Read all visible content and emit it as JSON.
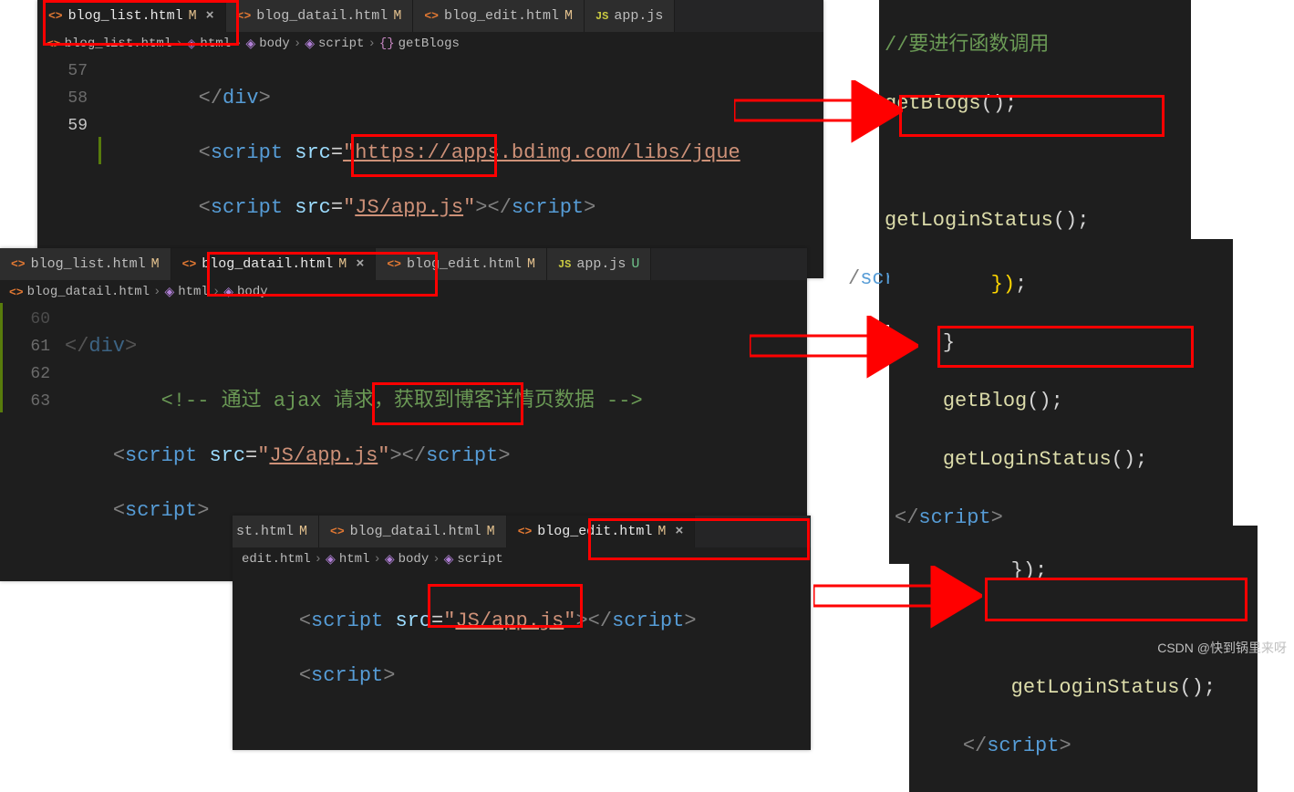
{
  "block1": {
    "tabs": [
      {
        "icon": "<>",
        "label": "blog_list.html",
        "flag": "M",
        "flagClass": "fm",
        "active": true,
        "close": true
      },
      {
        "icon": "<>",
        "label": "blog_datail.html",
        "flag": "M",
        "flagClass": "fm"
      },
      {
        "icon": "<>",
        "label": "blog_edit.html",
        "flag": "M",
        "flagClass": "fm"
      },
      {
        "icon": "JS",
        "label": "app.js",
        "flag": "",
        "iconClass": "js-icon"
      }
    ],
    "crumbs": [
      {
        "icon": "<>",
        "text": "blog_list.html",
        "iconClass": "file-icon"
      },
      {
        "icon": "◈",
        "text": "html",
        "iconClass": "cube"
      },
      {
        "icon": "◈",
        "text": "body",
        "iconClass": "cube"
      },
      {
        "icon": "◈",
        "text": "script",
        "iconClass": "cube"
      },
      {
        "icon": "{}",
        "text": "getBlogs",
        "iconClass": "bracket"
      }
    ],
    "lines": {
      "n57": "57",
      "n58": "58",
      "n59": "59",
      "l57_a": "</",
      "l57_b": "div",
      "l57_c": ">",
      "l58_a": "<",
      "l58_b": "script",
      "l58_c": " ",
      "l58_d": "src",
      "l58_e": "=",
      "l58_f": "\"https://apps.bdimg.com/libs/jque",
      "l59_a": "<",
      "l59_b": "script",
      "l59_c": " ",
      "l59_d": "src",
      "l59_e": "=",
      "l59_f": "\"",
      "l59_g": "JS/app.js",
      "l59_h": "\"",
      "l59_i": "></",
      "l59_j": "script",
      "l59_k": ">"
    }
  },
  "snippet1": {
    "l1": "//要进行函数调用",
    "l2a": "getBlogs",
    "l2b": "();",
    "l3": "",
    "l4a": "getLoginStatus",
    "l4b": "();",
    "l5a": "/",
    "l5b": "script",
    "l5c": ">"
  },
  "block2": {
    "tabs": [
      {
        "icon": "<>",
        "label": "blog_list.html",
        "flag": "M",
        "flagClass": "fm"
      },
      {
        "icon": "<>",
        "label": "blog_datail.html",
        "flag": "M",
        "flagClass": "fm",
        "active": true,
        "close": true
      },
      {
        "icon": "<>",
        "label": "blog_edit.html",
        "flag": "M",
        "flagClass": "fm"
      },
      {
        "icon": "JS",
        "label": "app.js",
        "flag": "U",
        "flagClass": "fu",
        "iconClass": "js-icon"
      }
    ],
    "crumbs": [
      {
        "icon": "<>",
        "text": "blog_datail.html",
        "iconClass": "file-icon"
      },
      {
        "icon": "◈",
        "text": "html",
        "iconClass": "cube"
      },
      {
        "icon": "◈",
        "text": "body",
        "iconClass": "cube"
      }
    ],
    "lines": {
      "n60": "60",
      "n61": "61",
      "n62": "62",
      "n63": "63",
      "l60_a": "</",
      "l60_b": "div",
      "l60_c": ">",
      "l61_a": "<!-- 通过 ajax 请求，获取到博客详情页数据 -->",
      "l62_a": "<",
      "l62_b": "script",
      "l62_c": " ",
      "l62_d": "src",
      "l62_e": "=",
      "l62_f": "\"",
      "l62_g": "JS/app.js",
      "l62_h": "\"",
      "l62_i": "></",
      "l62_j": "script",
      "l62_k": ">",
      "l63_a": "<",
      "l63_b": "script",
      "l63_c": ">"
    }
  },
  "snippet2": {
    "l0a": "})",
    "l0b": ";",
    "l1": "}",
    "l2a": "getBlog",
    "l2b": "();",
    "l3a": "getLoginStatus",
    "l3b": "();",
    "l4a": "</",
    "l4b": "script",
    "l4c": ">"
  },
  "block3": {
    "tabs": [
      {
        "label": "st.html",
        "flag": "M",
        "flagClass": "fm",
        "partial": true
      },
      {
        "icon": "<>",
        "label": "blog_datail.html",
        "flag": "M",
        "flagClass": "fm"
      },
      {
        "icon": "<>",
        "label": "blog_edit.html",
        "flag": "M",
        "flagClass": "fm",
        "active": true,
        "close": true
      }
    ],
    "crumbs": [
      {
        "text": "edit.html"
      },
      {
        "icon": "◈",
        "text": "html",
        "iconClass": "cube"
      },
      {
        "icon": "◈",
        "text": "body",
        "iconClass": "cube"
      },
      {
        "icon": "◈",
        "text": "script",
        "iconClass": "cube"
      }
    ],
    "lines": {
      "l1_a": "<",
      "l1_b": "script",
      "l1_c": " ",
      "l1_d": "src",
      "l1_e": "=",
      "l1_f": "\"",
      "l1_g": "JS/app.js",
      "l1_h": "\"",
      "l1_i": "></",
      "l1_j": "script",
      "l1_k": ">",
      "l2_a": "<",
      "l2_b": "script",
      "l2_c": ">"
    }
  },
  "snippet3": {
    "l0a": "});",
    "l1": "",
    "l2a": "getLoginStatus",
    "l2b": "();",
    "l3a": "</",
    "l3b": "script",
    "l3c": ">"
  },
  "watermark": "CSDN @快到锅里来呀"
}
